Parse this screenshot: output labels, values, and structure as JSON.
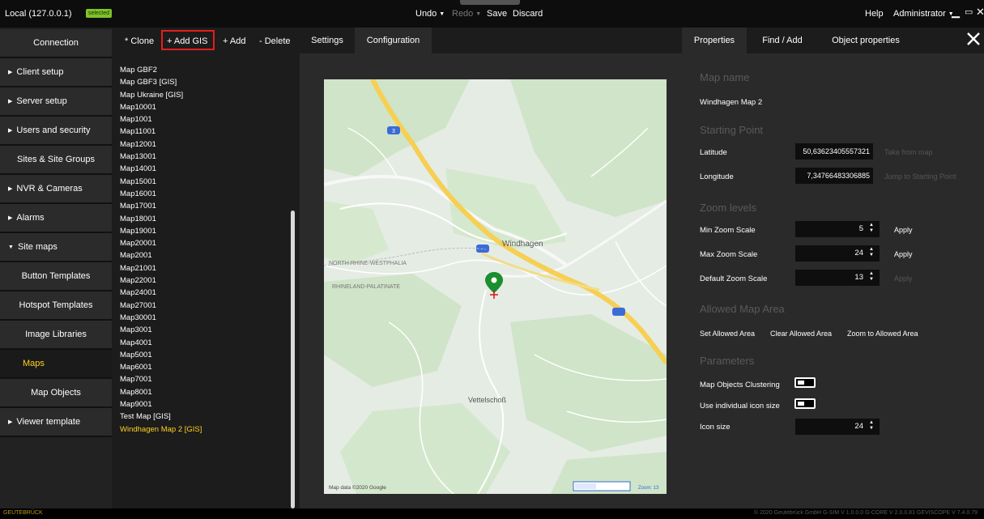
{
  "titlebar": {
    "server": "Local (127.0.0.1)",
    "badge": "selected",
    "undo": "Undo",
    "redo": "Redo",
    "save": "Save",
    "discard": "Discard",
    "help": "Help",
    "user": "Administrator"
  },
  "nav": {
    "items": [
      {
        "label": "Connection"
      },
      {
        "label": "Client setup"
      },
      {
        "label": "Server setup"
      },
      {
        "label": "Users and security"
      },
      {
        "label": "Sites & Site Groups"
      },
      {
        "label": "NVR & Cameras"
      },
      {
        "label": "Alarms"
      },
      {
        "label": "Site maps"
      },
      {
        "label": "Button Templates"
      },
      {
        "label": "Hotspot Templates"
      },
      {
        "label": "Image Libraries"
      },
      {
        "label": "Maps"
      },
      {
        "label": "Map Objects"
      },
      {
        "label": "Viewer template"
      }
    ]
  },
  "list": {
    "toolbar": {
      "clone": "* Clone",
      "add_gis": "+ Add GIS",
      "add": "+ Add",
      "delete": "- Delete"
    },
    "items": [
      "Map GBF2",
      "Map GBF3 [GIS]",
      "Map Ukraine [GIS]",
      "Map10001",
      "Map1001",
      "Map11001",
      "Map12001",
      "Map13001",
      "Map14001",
      "Map15001",
      "Map16001",
      "Map17001",
      "Map18001",
      "Map19001",
      "Map20001",
      "Map2001",
      "Map21001",
      "Map22001",
      "Map24001",
      "Map27001",
      "Map30001",
      "Map3001",
      "Map4001",
      "Map5001",
      "Map6001",
      "Map7001",
      "Map8001",
      "Map9001",
      "Test Map [GIS]",
      "Windhagen Map 2 [GIS]"
    ]
  },
  "center": {
    "tab_settings": "Settings",
    "tab_configuration": "Configuration",
    "map": {
      "town1": "Windhagen",
      "town2": "Vettelschoß",
      "region1": "NORTH RHINE-WESTPHALIA",
      "region2": "RHINELAND-PALATINATE",
      "attribution": "Map data ©2020 Google",
      "zoom_label": "Zoom: 13",
      "road_badge": "3"
    }
  },
  "right": {
    "tab_properties": "Properties",
    "tab_find": "Find / Add",
    "tab_object": "Object properties",
    "map_name_head": "Map name",
    "map_name": "Windhagen Map 2",
    "starting_head": "Starting Point",
    "latitude_label": "Latitude",
    "latitude": "50,63623405557321",
    "take_from_map": "Take from map",
    "longitude_label": "Longitude",
    "longitude": "7,34766483306885",
    "jump_to": "Jump to Starting Point",
    "zoom_head": "Zoom levels",
    "min_zoom_label": "Min Zoom Scale",
    "min_zoom": "5",
    "max_zoom_label": "Max Zoom Scale",
    "max_zoom": "24",
    "def_zoom_label": "Default Zoom Scale",
    "def_zoom": "13",
    "apply": "Apply",
    "area_head": "Allowed Map Area",
    "set_area": "Set Allowed Area",
    "clear_area": "Clear Allowed Area",
    "zoom_area": "Zoom to Allowed Area",
    "params_head": "Parameters",
    "clustering_label": "Map Objects Clustering",
    "icon_size_toggle_label": "Use individual icon size",
    "icon_size_label": "Icon size",
    "icon_size": "24"
  },
  "footer": {
    "left": "GEUTEBRÜCK",
    "right": "© 2020 Geutebrück GmbH   G-SIM V 1.0.0.0   G-CORE V 2.0.0.81   GEVISCOPE V 7.4.0.79"
  },
  "colors": {
    "accent": "#ffd21e",
    "badge": "#7fc22b",
    "highlight_box": "#e41e1e",
    "map_pin": "#1b8e2e"
  }
}
